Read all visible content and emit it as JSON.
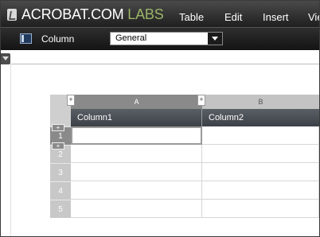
{
  "app": {
    "brand": "ACROBAT.COM",
    "brand_suffix": "LABS",
    "menu": [
      "Table",
      "Edit",
      "Insert",
      "Vie"
    ]
  },
  "toolbar": {
    "label": "Column",
    "format_value": "General"
  },
  "grid": {
    "column_letters": [
      "A",
      "B"
    ],
    "column_headers": [
      "Column1",
      "Column2"
    ],
    "row_numbers": [
      "1",
      "2",
      "3",
      "4",
      "5"
    ],
    "plus": "+"
  },
  "colors": {
    "brand_labs": "#9bb567",
    "header_bar": "#3c4148",
    "selected_row_tab": "#8a8a8a"
  }
}
